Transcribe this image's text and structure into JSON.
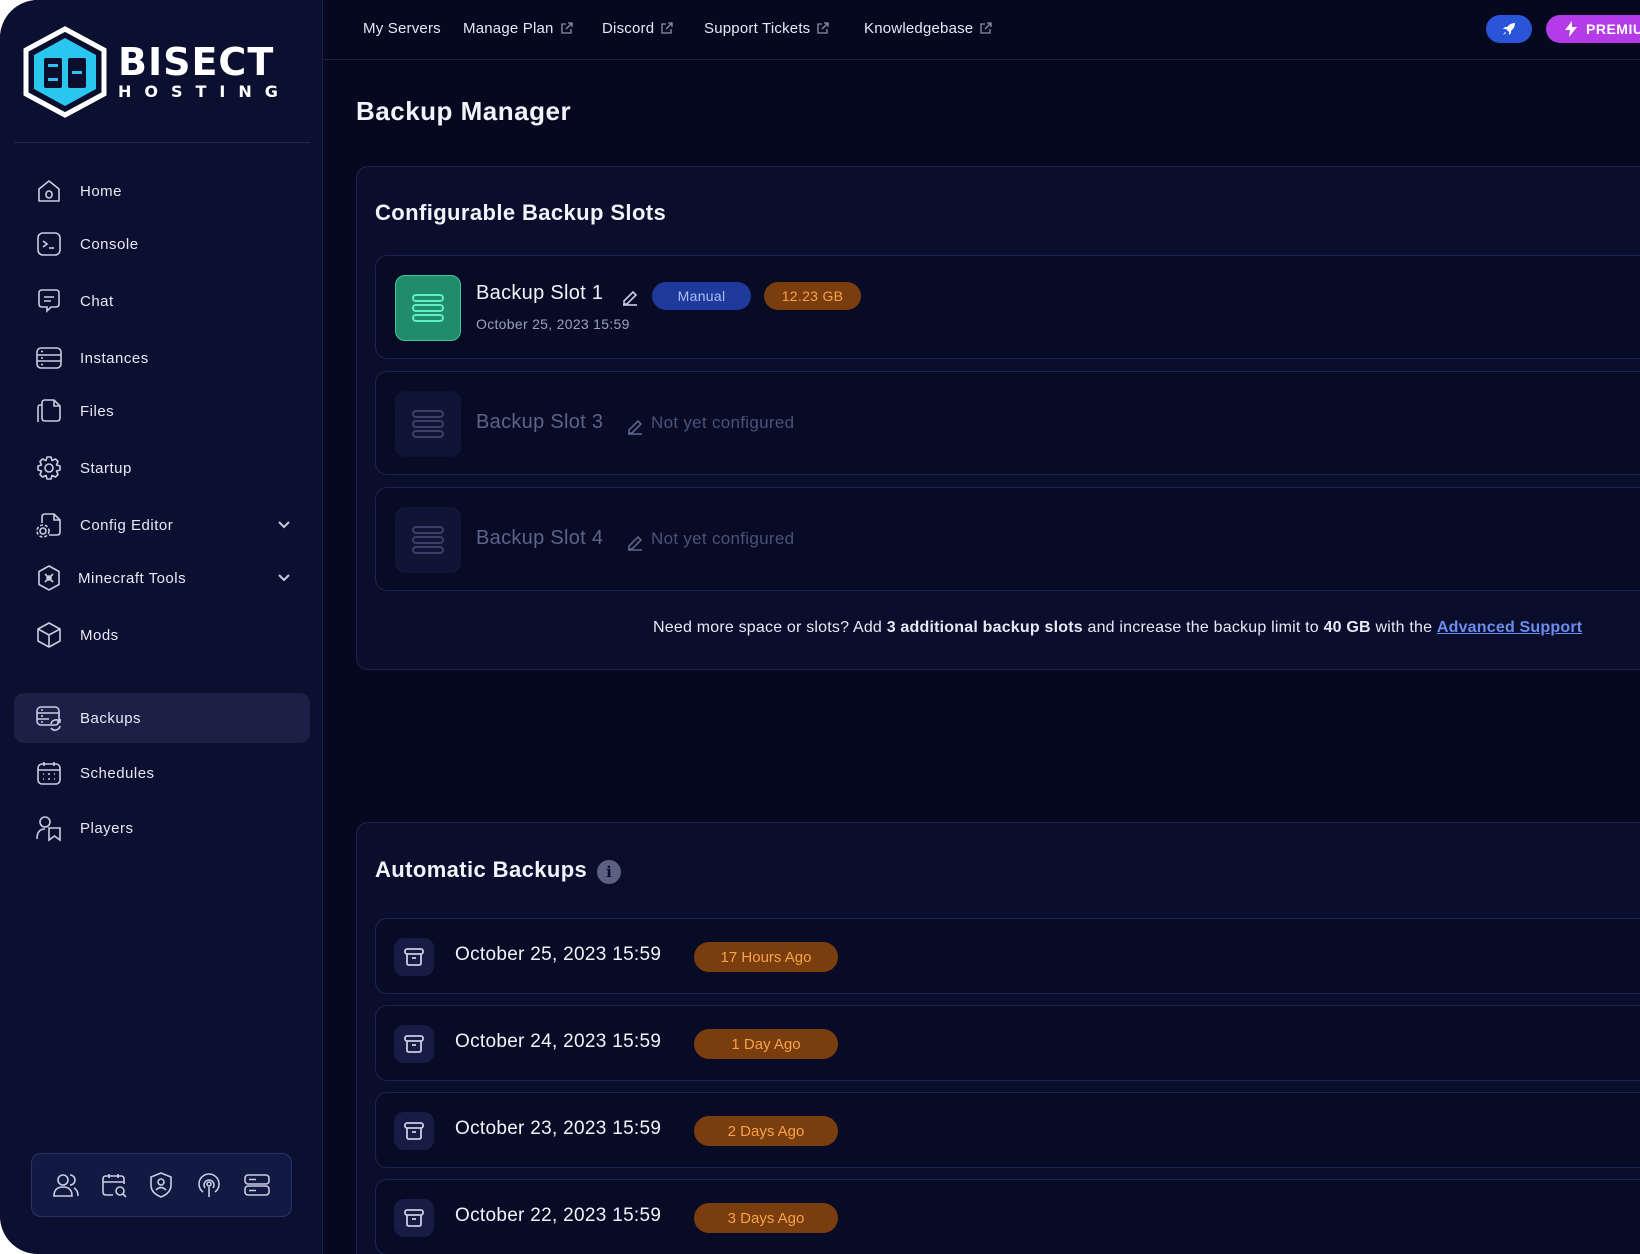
{
  "brand": {
    "logo_main": "BISECT",
    "logo_sub": "HOSTING"
  },
  "sidebar": {
    "items": [
      {
        "label": "Home",
        "icon": "home-icon"
      },
      {
        "label": "Console",
        "icon": "console-icon"
      },
      {
        "label": "Chat",
        "icon": "chat-icon"
      },
      {
        "label": "Instances",
        "icon": "instances-icon"
      },
      {
        "label": "Files",
        "icon": "files-icon"
      },
      {
        "label": "Startup",
        "icon": "gear-icon"
      },
      {
        "label": "Config Editor",
        "icon": "config-editor-icon"
      },
      {
        "label": "Minecraft Tools",
        "icon": "tools-icon"
      },
      {
        "label": "Mods",
        "icon": "cube-icon"
      },
      {
        "label": "Backups",
        "icon": "backups-icon",
        "active": true
      },
      {
        "label": "Schedules",
        "icon": "calendar-icon"
      },
      {
        "label": "Players",
        "icon": "players-icon"
      }
    ],
    "bottom_icons": [
      "users-icon",
      "calendar-search-icon",
      "shield-user-icon",
      "podcast-icon",
      "server-icon"
    ]
  },
  "topnav": {
    "links": [
      {
        "label": "My Servers",
        "external": false
      },
      {
        "label": "Manage Plan",
        "external": true
      },
      {
        "label": "Discord",
        "external": true
      },
      {
        "label": "Support Tickets",
        "external": true
      },
      {
        "label": "Knowledgebase",
        "external": true
      }
    ],
    "premium_label": "PREMIUM"
  },
  "page": {
    "title": "Backup Manager"
  },
  "configurable": {
    "title": "Configurable Backup Slots",
    "slots": [
      {
        "name": "Backup Slot 1",
        "date": "October 25, 2023 15:59",
        "type_badge": "Manual",
        "size_badge": "12.23 GB",
        "configured": true
      },
      {
        "name": "Backup Slot 3",
        "status": "Not yet configured",
        "configured": false
      },
      {
        "name": "Backup Slot 4",
        "status": "Not yet configured",
        "configured": false
      }
    ],
    "upsell": {
      "prefix": "Need more space or slots? Add ",
      "bold1": "3 additional backup slots",
      "middle": " and increase the backup limit to ",
      "bold2": "40 GB",
      "suffix": " with the ",
      "link": "Advanced Support"
    }
  },
  "automatic": {
    "title": "Automatic Backups",
    "info_icon": "info-icon",
    "rows": [
      {
        "date": "October 25, 2023 15:59",
        "ago": "17 Hours Ago"
      },
      {
        "date": "October 24, 2023 15:59",
        "ago": "1 Day Ago"
      },
      {
        "date": "October 23, 2023 15:59",
        "ago": "2 Days Ago"
      },
      {
        "date": "October 22, 2023 15:59",
        "ago": "3 Days Ago"
      }
    ]
  },
  "colors": {
    "background": "#06081f",
    "sidebar": "#0b1030",
    "accent_green": "#218c6c",
    "badge_blue": "#1f3a9a",
    "badge_orange": "#7a3d0e",
    "premium": "#b43be8",
    "rocket": "#2a55d8"
  }
}
